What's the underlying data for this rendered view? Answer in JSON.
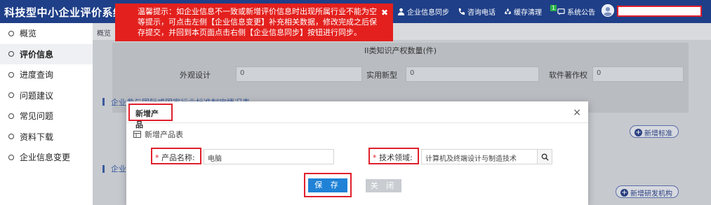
{
  "app": {
    "title": "科技型中小企业评价系统"
  },
  "header": {
    "nav": [
      {
        "label": "企业信息同步",
        "icon": "user-icon"
      },
      {
        "label": "咨询电话",
        "icon": "phone-icon"
      },
      {
        "label": "缓存清理",
        "icon": "recycle-icon"
      },
      {
        "label": "系统公告",
        "icon": "message-icon",
        "badge": "1"
      }
    ]
  },
  "toast": {
    "message": "温馨提示：如企业信息不一致或新增评价信息时出现所属行业不能为空等提示，可点击左侧【企业信息变更】补充相关数据，修改完成之后保存提交，并回到本页面点击右侧【企业信息同步】按钮进行同步。",
    "close": "✖"
  },
  "sidebar": {
    "items": [
      {
        "label": "概览"
      },
      {
        "label": "评价信息"
      },
      {
        "label": "进度查询"
      },
      {
        "label": "问题建议"
      },
      {
        "label": "常见问题"
      },
      {
        "label": "资料下载"
      },
      {
        "label": "企业信息变更"
      }
    ]
  },
  "main": {
    "breadcrumb": "概览",
    "ip_panel": {
      "heading": "II类知识产权数量(件)",
      "fields": [
        {
          "label": "外观设计",
          "value": "0"
        },
        {
          "label": "实用新型",
          "value": "0"
        },
        {
          "label": "软件著作权",
          "value": "0"
        }
      ]
    },
    "section1": {
      "title": "企业参与国际或国家行业标准制定情况表",
      "button": "新增标准"
    },
    "section2": {
      "title": "企业",
      "button": "新增研发机构"
    }
  },
  "modal": {
    "title": "新增产品",
    "close": "×",
    "form_heading": "新增产品表",
    "product_name": {
      "label": "产品名称:",
      "value": "电脑"
    },
    "tech_field": {
      "label": "技术领域:",
      "value": "计算机及终端设计与制造技术"
    },
    "save": "保 存",
    "close_button": "关 闭"
  }
}
